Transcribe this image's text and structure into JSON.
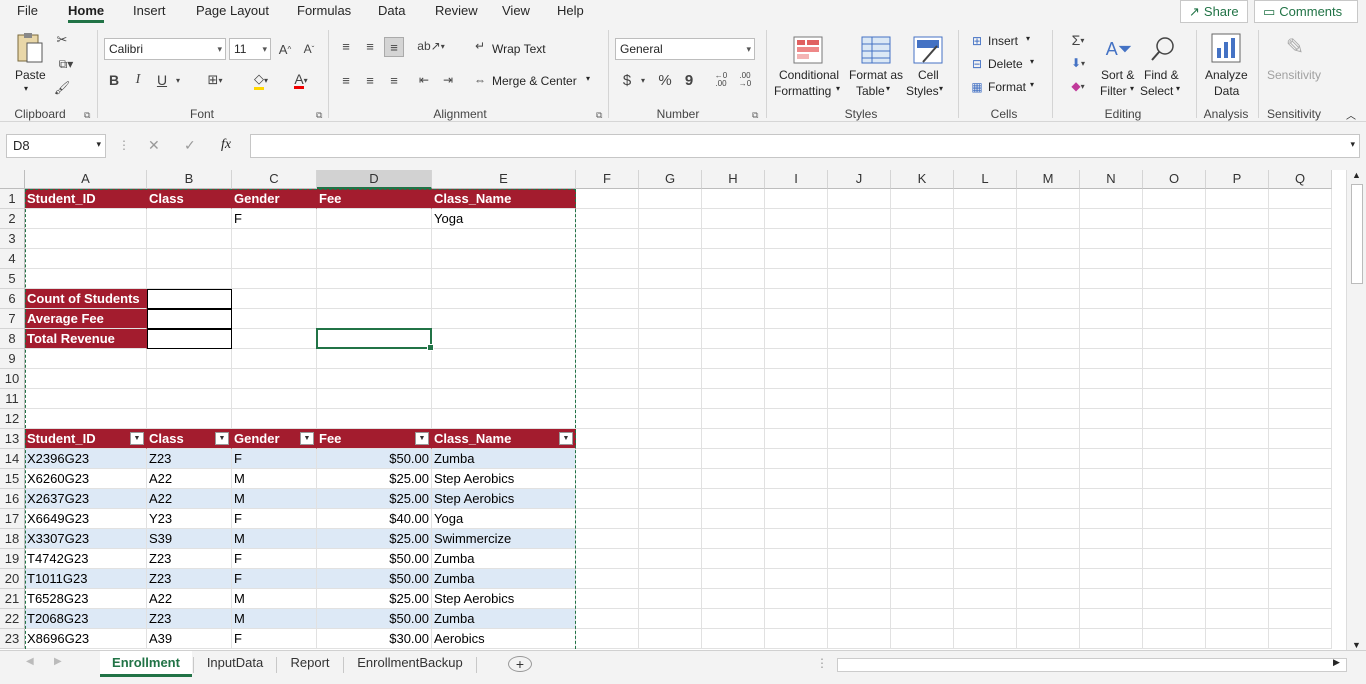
{
  "menu": {
    "items": [
      "File",
      "Home",
      "Insert",
      "Page Layout",
      "Formulas",
      "Data",
      "Review",
      "View",
      "Help"
    ],
    "active": "Home",
    "share": "Share",
    "comments": "Comments"
  },
  "ribbon": {
    "clipboard": {
      "paste": "Paste",
      "label": "Clipboard"
    },
    "font": {
      "name": "Calibri",
      "size": "11",
      "bold": "B",
      "italic": "I",
      "underline": "U",
      "label": "Font"
    },
    "alignment": {
      "wrap_text": "Wrap Text",
      "merge_center": "Merge & Center",
      "label": "Alignment"
    },
    "number": {
      "format": "General",
      "currency": "$",
      "percent": "%",
      "comma": "9",
      "inc_decimal": "←0 .00",
      "dec_decimal": ".00 →0",
      "label": "Number"
    },
    "styles": {
      "conditional": [
        "Conditional",
        "Formatting"
      ],
      "format_table": [
        "Format as",
        "Table"
      ],
      "cell_styles": [
        "Cell",
        "Styles"
      ],
      "label": "Styles"
    },
    "cells": {
      "insert": "Insert",
      "delete": "Delete",
      "format": "Format",
      "label": "Cells"
    },
    "editing": {
      "sort_filter": [
        "Sort &",
        "Filter"
      ],
      "find_select": [
        "Find &",
        "Select"
      ],
      "label": "Editing"
    },
    "analysis": {
      "analyze": [
        "Analyze",
        "Data"
      ],
      "label": "Analysis"
    },
    "sensitivity": {
      "button": "Sensitivity",
      "label": "Sensitivity"
    }
  },
  "formula_bar": {
    "name_box": "D8",
    "fx": "fx",
    "content": ""
  },
  "columns": [
    "A",
    "B",
    "C",
    "D",
    "E",
    "F",
    "G",
    "H",
    "I",
    "J",
    "K",
    "L",
    "M",
    "N",
    "O",
    "P",
    "Q"
  ],
  "rows": [
    "1",
    "2",
    "3",
    "4",
    "5",
    "6",
    "7",
    "8",
    "9",
    "10",
    "11",
    "12",
    "13",
    "14",
    "15",
    "16",
    "17",
    "18",
    "19",
    "20",
    "21",
    "22",
    "23"
  ],
  "criteria": {
    "headers": [
      "Student_ID",
      "Class",
      "Gender",
      "Fee",
      "Class_Name"
    ],
    "row2": {
      "gender": "F",
      "class_name": "Yoga"
    }
  },
  "summary": [
    {
      "label": "Count of Students",
      "value": ""
    },
    {
      "label": "Average Fee",
      "value": ""
    },
    {
      "label": "Total Revenue",
      "value": ""
    }
  ],
  "table": {
    "headers": [
      "Student_ID",
      "Class",
      "Gender",
      "Fee",
      "Class_Name"
    ],
    "rows": [
      [
        "X2396G23",
        "Z23",
        "F",
        "$50.00",
        "Zumba"
      ],
      [
        "X6260G23",
        "A22",
        "M",
        "$25.00",
        "Step Aerobics"
      ],
      [
        "X2637G23",
        "A22",
        "M",
        "$25.00",
        "Step Aerobics"
      ],
      [
        "X6649G23",
        "Y23",
        "F",
        "$40.00",
        "Yoga"
      ],
      [
        "X3307G23",
        "S39",
        "M",
        "$25.00",
        "Swimmercize"
      ],
      [
        "T4742G23",
        "Z23",
        "F",
        "$50.00",
        "Zumba"
      ],
      [
        "T1011G23",
        "Z23",
        "F",
        "$50.00",
        "Zumba"
      ],
      [
        "T6528G23",
        "A22",
        "M",
        "$25.00",
        "Step Aerobics"
      ],
      [
        "T2068G23",
        "Z23",
        "M",
        "$50.00",
        "Zumba"
      ],
      [
        "X8696G23",
        "A39",
        "F",
        "$30.00",
        "Aerobics"
      ]
    ]
  },
  "sheets": {
    "tabs": [
      "Enrollment",
      "InputData",
      "Report",
      "EnrollmentBackup"
    ],
    "active": "Enrollment",
    "add": "+"
  },
  "colors": {
    "header_red": "#a31c2e",
    "band_blue": "#dde9f6",
    "excel_green": "#217346"
  }
}
